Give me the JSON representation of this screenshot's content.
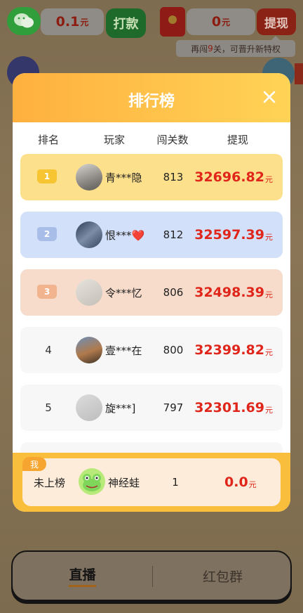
{
  "topbar": {
    "wechat_balance": "0.1",
    "currency": "元",
    "pay_label": "打款",
    "cash_balance": "0",
    "withdraw_label": "提现",
    "tip_prefix": "再闯",
    "tip_count": "9",
    "tip_suffix": "关，可晋升新特权"
  },
  "modal": {
    "title": "排行榜",
    "columns": {
      "rank": "排名",
      "player": "玩家",
      "levels": "闯关数",
      "withdraw": "提现"
    },
    "rows": [
      {
        "rank": "1",
        "name": "青***隐",
        "levels": "813",
        "cash": "32696.82",
        "unit": "元"
      },
      {
        "rank": "2",
        "name": "恨***❤️",
        "levels": "812",
        "cash": "32597.39",
        "unit": "元"
      },
      {
        "rank": "3",
        "name": "令***忆",
        "levels": "806",
        "cash": "32498.39",
        "unit": "元"
      },
      {
        "rank": "4",
        "name": "壹***在",
        "levels": "800",
        "cash": "32399.82",
        "unit": "元"
      },
      {
        "rank": "5",
        "name": "旋***]",
        "levels": "797",
        "cash": "32301.69",
        "unit": "元"
      }
    ],
    "me": {
      "tag": "我",
      "rank": "未上榜",
      "name": "神经蛙",
      "levels": "1",
      "cash": "0.0",
      "unit": "元"
    }
  },
  "tabs": {
    "live": "直播",
    "group": "红包群"
  },
  "colors": {
    "header_start": "#ffb03f",
    "header_end": "#ffd356",
    "cash_red": "#e0261b",
    "gold": "#fde08c",
    "silver": "#d3e0fa",
    "bronze": "#f7dccb"
  }
}
